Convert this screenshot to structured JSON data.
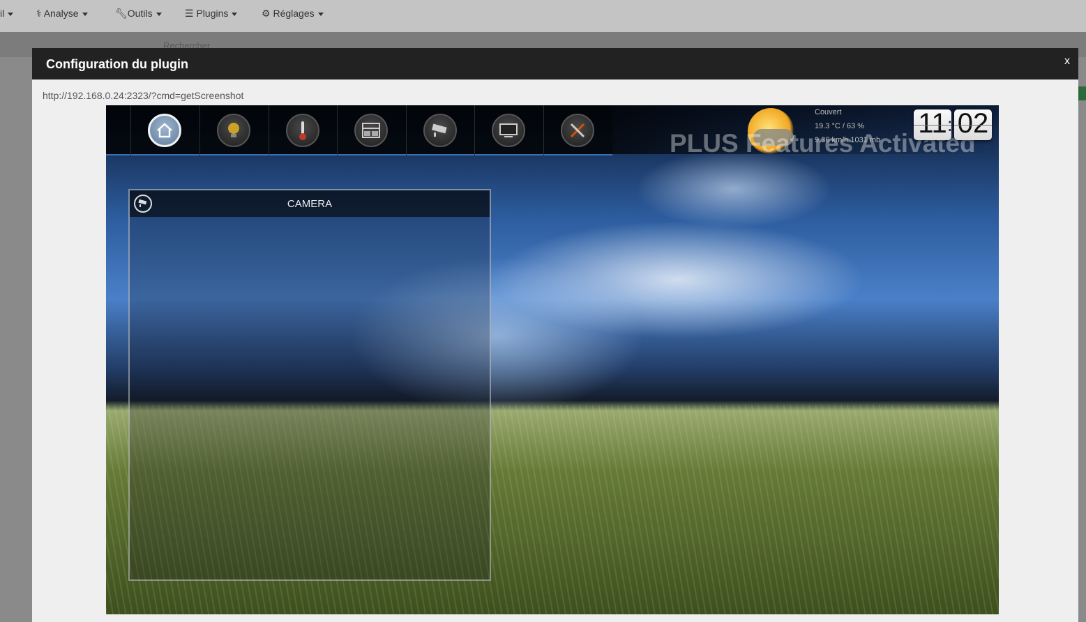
{
  "app_nav": {
    "items": [
      {
        "label": "il"
      },
      {
        "label": "Analyse"
      },
      {
        "label": "Outils"
      },
      {
        "label": "Plugins"
      },
      {
        "label": "Réglages"
      }
    ],
    "search_placeholder": "Rechercher"
  },
  "modal": {
    "title": "Configuration du plugin",
    "close_label": "x",
    "url": "http://192.168.0.24:2323/?cmd=getScreenshot"
  },
  "screenshot": {
    "nav_icons": [
      "home-icon",
      "lightbulb-icon",
      "thermometer-icon",
      "shutter-icon",
      "camera-icon",
      "screen-icon",
      "tools-icon"
    ],
    "active_nav": "home-icon",
    "banner": "PLUS Features Activated",
    "weather": {
      "condition": "Couvert",
      "temp_humidity": "19.3 °C / 63 %",
      "wind_pressure": "9.36 km/h 1031 mb"
    },
    "clock": {
      "hours": "11",
      "minutes": "02"
    },
    "camera_panel": {
      "title": "CAMERA"
    },
    "colors": {
      "accent_line": "#3a6fb3",
      "modal_header": "#222222"
    }
  }
}
